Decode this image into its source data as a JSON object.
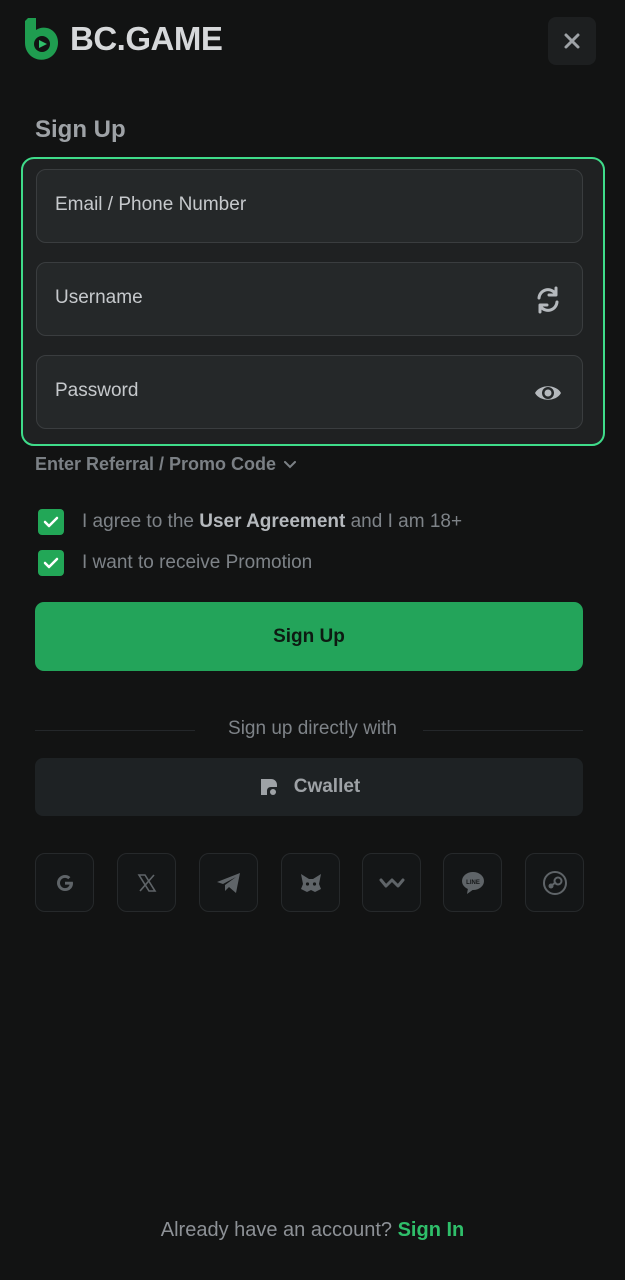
{
  "brand": {
    "name": "BC.GAME",
    "accent": "#23a45a",
    "highlight": "#3fdc8a"
  },
  "page": {
    "title": "Sign Up"
  },
  "form": {
    "email_label": "Email / Phone Number",
    "username_label": "Username",
    "password_label": "Password",
    "username_icon": "refresh-icon",
    "password_icon": "eye-icon"
  },
  "promo": {
    "label": "Enter Referral / Promo Code"
  },
  "agreements": {
    "agree_prefix": "I agree to the ",
    "agree_link": "User Agreement",
    "agree_suffix": " and I am 18+",
    "promotion": "I want to receive Promotion"
  },
  "actions": {
    "signup_label": "Sign Up"
  },
  "social": {
    "divider_text": "Sign up directly with",
    "cwallet_label": "Cwallet",
    "providers": [
      "google-icon",
      "x-icon",
      "telegram-icon",
      "metamask-icon",
      "walletconnect-icon",
      "line-icon",
      "steam-icon"
    ]
  },
  "footer": {
    "prompt": "Already have an account? ",
    "signin_label": "Sign In"
  }
}
